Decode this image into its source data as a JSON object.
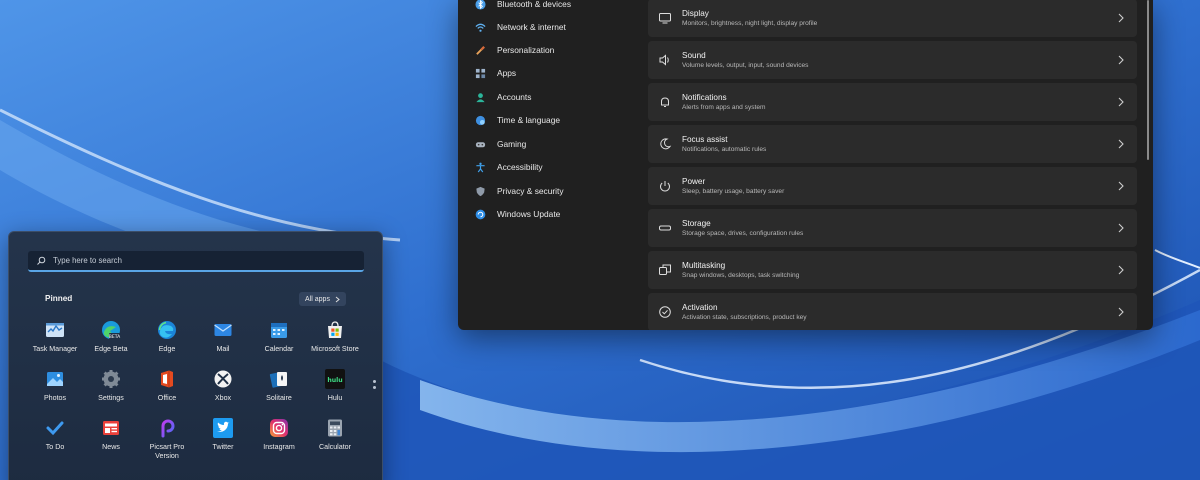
{
  "settings": {
    "nav": [
      {
        "label": "Bluetooth & devices",
        "icon": "bluetooth-icon"
      },
      {
        "label": "Network & internet",
        "icon": "wifi-icon"
      },
      {
        "label": "Personalization",
        "icon": "brush-icon"
      },
      {
        "label": "Apps",
        "icon": "apps-icon"
      },
      {
        "label": "Accounts",
        "icon": "person-icon"
      },
      {
        "label": "Time & language",
        "icon": "globe-clock-icon"
      },
      {
        "label": "Gaming",
        "icon": "gamepad-icon"
      },
      {
        "label": "Accessibility",
        "icon": "accessibility-icon"
      },
      {
        "label": "Privacy & security",
        "icon": "shield-icon"
      },
      {
        "label": "Windows Update",
        "icon": "update-icon"
      }
    ],
    "cards": [
      {
        "title": "Display",
        "subtitle": "Monitors, brightness, night light, display profile",
        "icon": "monitor-icon"
      },
      {
        "title": "Sound",
        "subtitle": "Volume levels, output, input, sound devices",
        "icon": "speaker-icon"
      },
      {
        "title": "Notifications",
        "subtitle": "Alerts from apps and system",
        "icon": "bell-icon"
      },
      {
        "title": "Focus assist",
        "subtitle": "Notifications, automatic rules",
        "icon": "moon-icon"
      },
      {
        "title": "Power",
        "subtitle": "Sleep, battery usage, battery saver",
        "icon": "power-icon"
      },
      {
        "title": "Storage",
        "subtitle": "Storage space, drives, configuration rules",
        "icon": "storage-icon"
      },
      {
        "title": "Multitasking",
        "subtitle": "Snap windows, desktops, task switching",
        "icon": "multitask-icon"
      },
      {
        "title": "Activation",
        "subtitle": "Activation state, subscriptions, product key",
        "icon": "check-circle-icon"
      }
    ]
  },
  "start": {
    "search_placeholder": "Type here to search",
    "pinned_label": "Pinned",
    "all_apps_label": "All apps",
    "apps": [
      {
        "label": "Task Manager",
        "icon": "task-manager-icon"
      },
      {
        "label": "Edge Beta",
        "icon": "edge-beta-icon"
      },
      {
        "label": "Edge",
        "icon": "edge-icon"
      },
      {
        "label": "Mail",
        "icon": "mail-icon"
      },
      {
        "label": "Calendar",
        "icon": "calendar-icon"
      },
      {
        "label": "Microsoft Store",
        "icon": "store-icon"
      },
      {
        "label": "Photos",
        "icon": "photos-icon"
      },
      {
        "label": "Settings",
        "icon": "settings-gear-icon"
      },
      {
        "label": "Office",
        "icon": "office-icon"
      },
      {
        "label": "Xbox",
        "icon": "xbox-icon"
      },
      {
        "label": "Solitaire",
        "icon": "solitaire-icon"
      },
      {
        "label": "Hulu",
        "icon": "hulu-icon"
      },
      {
        "label": "To Do",
        "icon": "todo-icon"
      },
      {
        "label": "News",
        "icon": "news-icon"
      },
      {
        "label": "Picsart Pro Version",
        "icon": "picsart-icon"
      },
      {
        "label": "Twitter",
        "icon": "twitter-icon"
      },
      {
        "label": "Instagram",
        "icon": "instagram-icon"
      },
      {
        "label": "Calculator",
        "icon": "calculator-icon"
      }
    ]
  },
  "colors": {
    "accent": "#5aa5e6",
    "settings_bg": "#202020",
    "card_bg": "#2b2b2b",
    "start_bg": "#24344b"
  }
}
